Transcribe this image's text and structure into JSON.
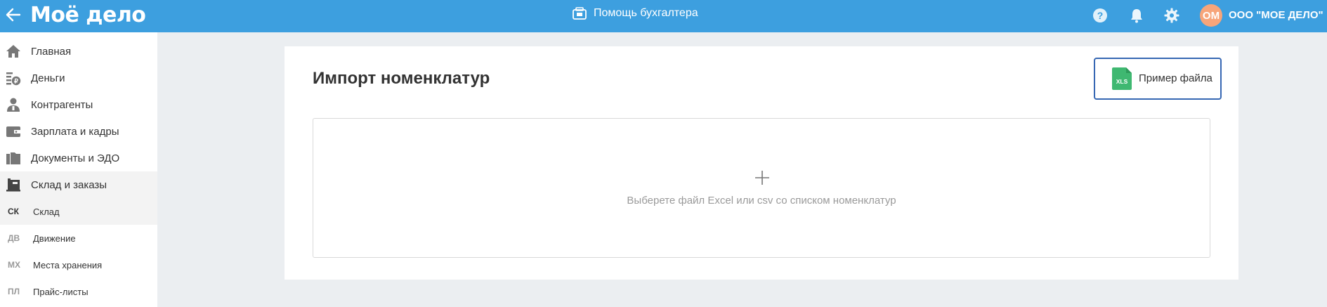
{
  "header": {
    "logo": "Моё дело",
    "helper_label": "Помощь бухгалтера",
    "avatar_initials": "ОМ",
    "org_name": "ООО \"МОЕ ДЕЛО\"",
    "icons": [
      "back-arrow-icon",
      "help-icon",
      "bell-icon",
      "gear-icon"
    ],
    "accent_color": "#3d9fdf"
  },
  "sidebar": {
    "items": [
      {
        "label": "Главная",
        "icon": "home-icon"
      },
      {
        "label": "Деньги",
        "icon": "money-icon"
      },
      {
        "label": "Контрагенты",
        "icon": "contractors-icon"
      },
      {
        "label": "Зарплата и кадры",
        "icon": "wallet-icon"
      },
      {
        "label": "Документы и ЭДО",
        "icon": "folder-icon"
      },
      {
        "label": "Склад и заказы",
        "icon": "warehouse-icon"
      }
    ],
    "subitems": [
      {
        "abbr": "СК",
        "label": "Склад"
      },
      {
        "abbr": "ДВ",
        "label": "Движение"
      },
      {
        "abbr": "МХ",
        "label": "Места хранения"
      },
      {
        "abbr": "ПЛ",
        "label": "Прайс-листы"
      }
    ]
  },
  "main": {
    "title": "Импорт номенклатур",
    "sample_button_label": "Пример файла",
    "xls_badge": "XLS",
    "dropzone_text": "Выберете файл Excel или csv со списком номенклатур",
    "button_border_color": "#3667b3",
    "xls_color": "#3fb871"
  }
}
